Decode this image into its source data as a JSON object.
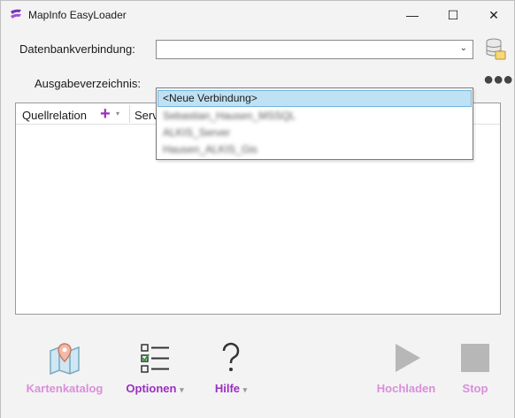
{
  "window": {
    "title": "MapInfo EasyLoader",
    "minimize": "—",
    "maximize": "☐",
    "close": "✕"
  },
  "form": {
    "db_label": "Datenbankverbindung:",
    "db_value": "",
    "out_label": "Ausgabeverzeichnis:",
    "more": "●●●"
  },
  "dropdown": {
    "items": [
      {
        "label": "<Neue Verbindung>",
        "selected": true
      },
      {
        "label": "Sebastian_Hausen_MSSQL",
        "selected": false
      },
      {
        "label": "ALKIS_Server",
        "selected": false
      },
      {
        "label": "Hausen_ALKIS_Gis",
        "selected": false
      }
    ]
  },
  "table": {
    "col_source": "Quellrelation",
    "col_server": "Serv",
    "add_symbol": "+",
    "add_caret": "▾"
  },
  "toolbar": {
    "catalog": "Kartenkatalog",
    "options": "Optionen",
    "help": "Hilfe",
    "upload": "Hochladen",
    "stop": "Stop",
    "caret": "▾"
  },
  "colors": {
    "accent": "#9b2fc0",
    "disabled": "#d98fd9",
    "disabled_icon": "#b7b7b7"
  }
}
